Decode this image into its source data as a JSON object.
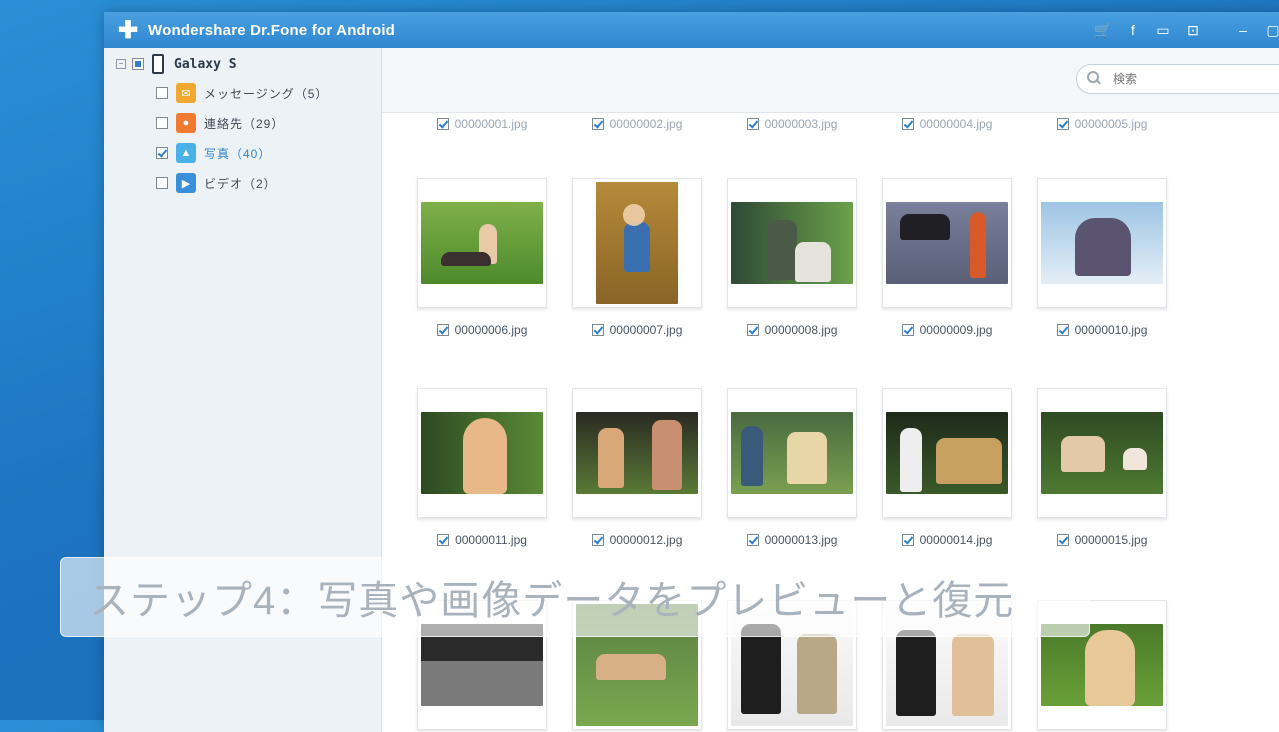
{
  "window": {
    "title": "Wondershare Dr.Fone for Android"
  },
  "titlebar_icons": [
    "cart-icon",
    "facebook-icon",
    "chat-icon",
    "feedback-icon",
    "minimize-icon",
    "maximize-icon"
  ],
  "sidebar": {
    "device": "Galaxy S",
    "items": [
      {
        "label": "メッセージング（5）",
        "icon": "message-icon",
        "color": "#f0a830",
        "checked": false
      },
      {
        "label": "連絡先（29）",
        "icon": "contact-icon",
        "color": "#f07a30",
        "checked": false
      },
      {
        "label": "写真（40）",
        "icon": "photo-icon",
        "color": "#4ab0e8",
        "checked": true
      },
      {
        "label": "ビデオ（2）",
        "icon": "video-icon",
        "color": "#3a8fd8",
        "checked": false
      }
    ]
  },
  "search": {
    "placeholder": "検索"
  },
  "photos": {
    "partial_row": [
      "00000001.jpg",
      "00000002.jpg",
      "00000003.jpg",
      "00000004.jpg",
      "00000005.jpg"
    ],
    "row1": [
      "00000006.jpg",
      "00000007.jpg",
      "00000008.jpg",
      "00000009.jpg",
      "00000010.jpg"
    ],
    "row2": [
      "00000011.jpg",
      "00000012.jpg",
      "00000013.jpg",
      "00000014.jpg",
      "00000015.jpg"
    ]
  },
  "caption": "ステップ4：写真や画像データをプレビューと復元",
  "colors": {
    "titlebar": "#2f86cf",
    "sidebar_bg": "#edf2f7",
    "accent": "#2f7fd0"
  }
}
